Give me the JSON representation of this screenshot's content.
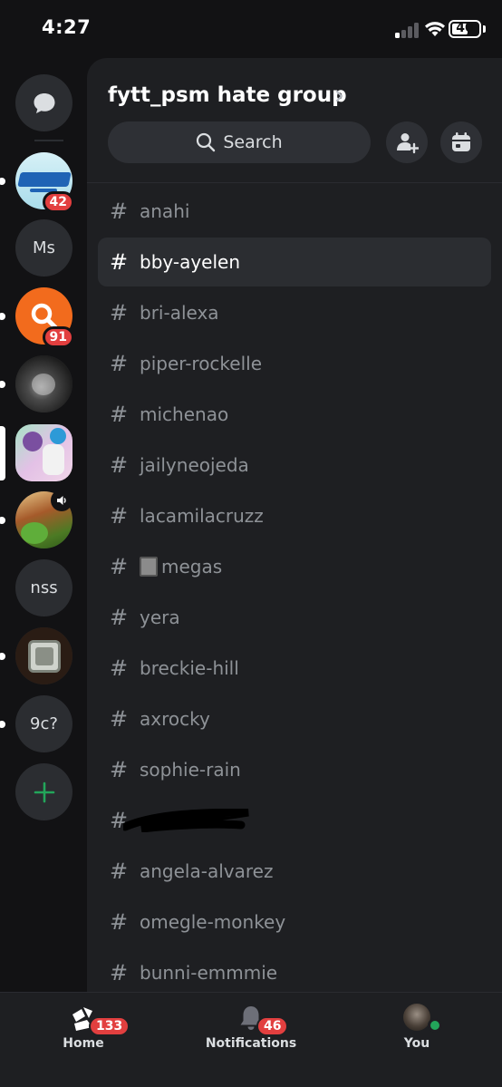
{
  "status_bar": {
    "time": "4:27",
    "battery": "40"
  },
  "servers": [
    {
      "id": "dm",
      "icon": "chat-bubble-icon"
    },
    {
      "id": "server-1",
      "badge": "42",
      "unread": true,
      "colors": [
        "#bfe8f2",
        "#1e5aa8"
      ]
    },
    {
      "id": "server-ms",
      "label": "Ms"
    },
    {
      "id": "server-3",
      "badge": "91",
      "unread": true,
      "colors": [
        "#f26b1d"
      ]
    },
    {
      "id": "server-4",
      "unread": true,
      "colors": [
        "#333333"
      ]
    },
    {
      "id": "server-5",
      "active": true,
      "colors": [
        "#c7a5d8"
      ]
    },
    {
      "id": "server-6",
      "unread": true,
      "speaker": true,
      "colors": [
        "#6b8a3a"
      ]
    },
    {
      "id": "server-nss",
      "label": "nss"
    },
    {
      "id": "server-8",
      "unread": true,
      "colors": [
        "#3a2a20"
      ]
    },
    {
      "id": "server-9c",
      "label": "9c?",
      "unread": true
    },
    {
      "id": "add-server",
      "icon": "plus-icon"
    }
  ],
  "guild": {
    "name": "fytt_psm hate group",
    "search_label": "Search"
  },
  "channels": [
    {
      "name": "anahi"
    },
    {
      "name": "bby-ayelen",
      "selected": true
    },
    {
      "name": "bri-alexa"
    },
    {
      "name": "piper-rockelle"
    },
    {
      "name": "michenao"
    },
    {
      "name": "jailyneojeda"
    },
    {
      "name": "lacamilacruzz"
    },
    {
      "name": "megas",
      "emoji": "notebook-icon"
    },
    {
      "name": "yera"
    },
    {
      "name": "breckie-hill"
    },
    {
      "name": "axrocky"
    },
    {
      "name": "sophie-rain"
    },
    {
      "name": "",
      "redacted": true
    },
    {
      "name": "angela-alvarez"
    },
    {
      "name": "omegle-monkey"
    },
    {
      "name": "bunni-emmmie"
    }
  ],
  "tabbar": {
    "home": {
      "label": "Home",
      "badge": "133"
    },
    "notifications": {
      "label": "Notifications",
      "badge": "46"
    },
    "you": {
      "label": "You"
    }
  },
  "colors": {
    "badge": "#e23f3f",
    "online": "#23a55a",
    "add": "#23a55a"
  }
}
